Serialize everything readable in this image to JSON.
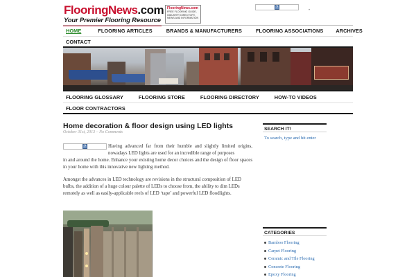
{
  "header": {
    "logo_text_red": "FlooringNews",
    "logo_text_dark": ".com",
    "tagline": "Your Premier Flooring Resource",
    "badge_title": "FlooringNews.com",
    "badge_lines": [
      "FREE FLOORING GUIDE,",
      "INDUSTRY DIRECTORY,",
      "NEWS AND INFORMATION"
    ],
    "search_button": "?"
  },
  "nav_primary": {
    "items": [
      {
        "label": "HOME",
        "active": true
      },
      {
        "label": "FLOORING ARTICLES",
        "active": false
      },
      {
        "label": "BRANDS & MANUFACTURERS",
        "active": false
      },
      {
        "label": "FLOORING ASSOCIATIONS",
        "active": false
      },
      {
        "label": "ARCHIVES",
        "active": false
      },
      {
        "label": "CONTACT",
        "active": false
      }
    ]
  },
  "nav_secondary": {
    "items": [
      {
        "label": "FLOORING GLOSSARY"
      },
      {
        "label": "FLOORING STORE"
      },
      {
        "label": "FLOORING DIRECTORY"
      },
      {
        "label": "HOW-TO VIDEOS"
      },
      {
        "label": "FLOOR CONTRACTORS"
      }
    ]
  },
  "post": {
    "title": "Home decoration & floor design using LED lights",
    "date": "October 31st, 2013",
    "separator": " – ",
    "comments": "No Comments",
    "inline_button": "?",
    "para1_first": "Having advanced far from their humble and slightly limited origins, nowadays LED lights are used for an incredible range of purposes",
    "para1_rest": "in and around the home. Enhance your existing home decor choices and the design of floor spaces in your home with this innovative new lighting method.",
    "para2": "Amongst the advances in LED technology are revisions in the structural composition of LED bulbs, the addition of a huge colour palette of LEDs to choose from, the ability to dim LEDs remotely as well as easily-applicable reels of LED ‘tape’ and powerful LED floodlights."
  },
  "sidebar": {
    "search_title": "SEARCH IT!",
    "search_placeholder": "To search, type and hit enter",
    "categories_title": "CATEGORIES",
    "categories": [
      "Bamboo Flooring",
      "Carpet Flooring",
      "Ceramic and Tile Flooring",
      "Concrete Flooring",
      "Epoxy Flooring"
    ]
  },
  "colors": {
    "brand_red": "#c8102e",
    "active_nav": "#2a8a2a",
    "link_blue": "#2a6bb0"
  }
}
